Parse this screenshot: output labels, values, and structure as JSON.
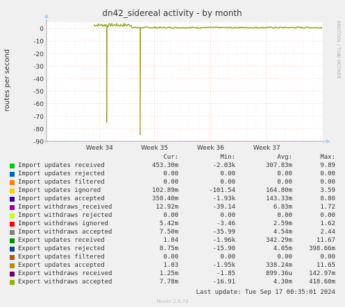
{
  "chart_data": {
    "type": "line",
    "title": "dn42_sidereal activity - by month",
    "ylabel": "routes per second",
    "side_label": "RRDTOOL / TOBI OETIKER",
    "ylim": [
      -90,
      5
    ],
    "yticks": [
      0,
      -10,
      -20,
      -30,
      -40,
      -50,
      -60,
      -70,
      -80,
      -90
    ],
    "xticks": [
      {
        "label": "Week 34",
        "pos": 0.192
      },
      {
        "label": "Week 35",
        "pos": 0.391
      },
      {
        "label": "Week 36",
        "pos": 0.594
      },
      {
        "label": "Week 37",
        "pos": 0.797
      }
    ],
    "grid": true,
    "spikes": [
      {
        "pos": 0.218,
        "value": -75
      },
      {
        "pos": 0.339,
        "value": -85
      }
    ],
    "data_start_pos": 0.171,
    "series_color": "#8c8c00"
  },
  "legend": {
    "headers": {
      "cur": "Cur:",
      "min": "Min:",
      "avg": "Avg:",
      "max": "Max:"
    },
    "rows": [
      {
        "name": "Import updates received",
        "cur": "453.30m",
        "min": "-2.03k",
        "avg": "307.83m",
        "max": "9.89",
        "color": "#00cc00"
      },
      {
        "name": "Import updates rejected",
        "cur": "0.00",
        "min": "0.00",
        "avg": "0.00",
        "max": "0.00",
        "color": "#0066b3"
      },
      {
        "name": "Import updates filtered",
        "cur": "0.00",
        "min": "0.00",
        "avg": "0.00",
        "max": "0.00",
        "color": "#ff8000"
      },
      {
        "name": "Import updates ignored",
        "cur": "102.89m",
        "min": "-101.54",
        "avg": "164.80m",
        "max": "3.59",
        "color": "#ffcc00"
      },
      {
        "name": "Import updates accepted",
        "cur": "350.40m",
        "min": "-1.93k",
        "avg": "143.33m",
        "max": "8.80",
        "color": "#330099"
      },
      {
        "name": "Import withdraws_received",
        "cur": "12.92m",
        "min": "-39.14",
        "avg": "6.83m",
        "max": "1.72",
        "color": "#990099"
      },
      {
        "name": "Import withdraws rejected",
        "cur": "0.00",
        "min": "0.00",
        "avg": "0.00",
        "max": "0.00",
        "color": "#ccff00"
      },
      {
        "name": "Import withdraws ignored",
        "cur": "5.42m",
        "min": "-3.46",
        "avg": "2.59m",
        "max": "1.62",
        "color": "#ff0000"
      },
      {
        "name": "Import withdraws accepted",
        "cur": "7.50m",
        "min": "-35.99",
        "avg": "4.54m",
        "max": "2.44",
        "color": "#808080"
      },
      {
        "name": "Export updates received",
        "cur": "1.04",
        "min": "-1.96k",
        "avg": "342.29m",
        "max": "11.67",
        "color": "#008f00"
      },
      {
        "name": "Export updates rejected",
        "cur": "8.75m",
        "min": "-15.90",
        "avg": "4.05m",
        "max": "398.66m",
        "color": "#00487d"
      },
      {
        "name": "Export updates filtered",
        "cur": "0.00",
        "min": "0.00",
        "avg": "0.00",
        "max": "0.00",
        "color": "#b35a00"
      },
      {
        "name": "Export updates accepted",
        "cur": "1.03",
        "min": "-1.95k",
        "avg": "338.24m",
        "max": "11.65",
        "color": "#b38f00"
      },
      {
        "name": "Export withdraws received",
        "cur": "1.25m",
        "min": "-1.85",
        "avg": "899.36u",
        "max": "142.97m",
        "color": "#6b006b"
      },
      {
        "name": "Export withdraws accepted",
        "cur": "7.78m",
        "min": "-16.91",
        "avg": "4.30m",
        "max": "418.60m",
        "color": "#8fb300"
      }
    ]
  },
  "last_update": "Last update: Tue Sep 17 00:35:01 2024",
  "footer": "Munin 2.0.73"
}
